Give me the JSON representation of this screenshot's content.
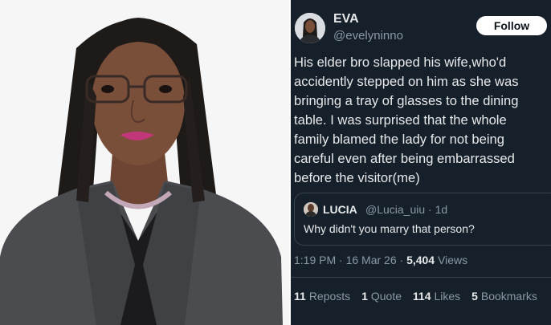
{
  "photo": {
    "subject": "woman-portrait",
    "background_color": "#f6f6f6",
    "blazer_color": "#4a4c50",
    "skin_color": "#7a4f3a",
    "hair_color": "#1d1a18",
    "lip_color": "#c2377a"
  },
  "tweet": {
    "background_color": "#15202b",
    "author": {
      "display_name": "EVA",
      "handle": "@evelyninno"
    },
    "follow_label": "Follow",
    "body_lines": [
      "His elder bro slapped his wife,who'd",
      "accidently stepped on him as she was",
      "bringing a tray of glasses to the dining",
      "table. I was surprised that the whole",
      "family blamed the lady for not being",
      "careful even after being embarrassed",
      "before the visitor(me)"
    ],
    "quote": {
      "name": "LUCIA",
      "handle_time": "@Lucia_uiu · 1d",
      "text": "Why didn't you marry that person?"
    },
    "meta": {
      "timestamp": "1:19 PM · 16 Mar 26 · ",
      "views_count": "5,404",
      "views_label": " Views"
    },
    "stats": [
      {
        "count": "11",
        "label": "Reposts"
      },
      {
        "count": "1",
        "label": "Quote"
      },
      {
        "count": "114",
        "label": "Likes"
      },
      {
        "count": "5",
        "label": "Bookmarks"
      }
    ]
  }
}
